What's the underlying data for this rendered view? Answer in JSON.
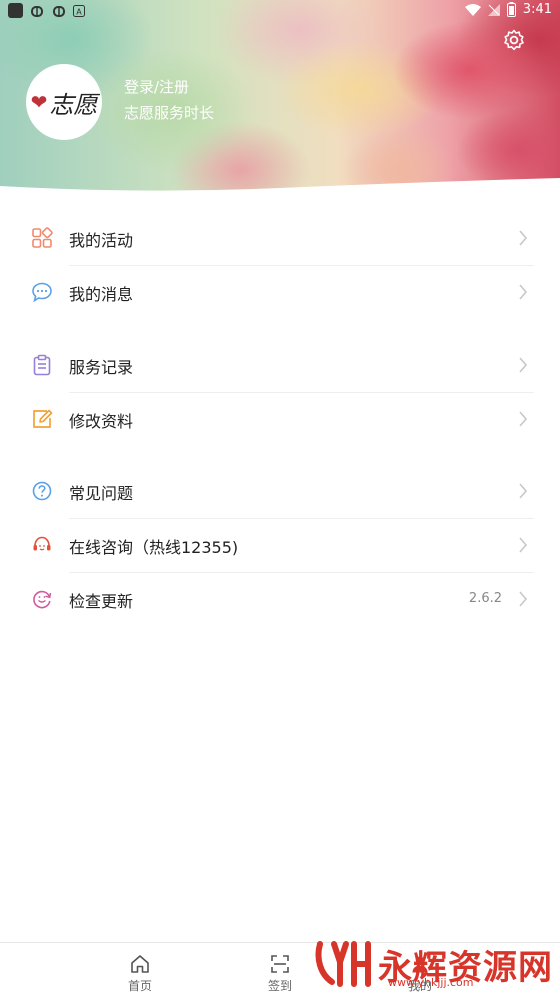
{
  "status_bar": {
    "time": "3:41"
  },
  "profile": {
    "avatar_text": "志愿",
    "login_label": "登录/注册",
    "hours_label": "志愿服务时长"
  },
  "menu": [
    {
      "label": "我的活动",
      "icon": "grid-icon",
      "color": "#f08a6a"
    },
    {
      "label": "我的消息",
      "icon": "chat-bubble-icon",
      "color": "#5aa0e6"
    },
    {
      "label": "服务记录",
      "icon": "clipboard-icon",
      "color": "#9a7fd8"
    },
    {
      "label": "修改资料",
      "icon": "edit-icon",
      "color": "#f2a23a"
    },
    {
      "label": "常见问题",
      "icon": "question-icon",
      "color": "#5aa0e6"
    },
    {
      "label": "在线咨询（热线12355)",
      "icon": "headset-icon",
      "color": "#e0503c"
    },
    {
      "label": "检查更新",
      "icon": "refresh-smile-icon",
      "color": "#d05aa0",
      "value": "2.6.2"
    }
  ],
  "tabbar": [
    {
      "label": "首页",
      "icon": "home-icon"
    },
    {
      "label": "签到",
      "icon": "scan-icon"
    },
    {
      "label": "我的",
      "icon": "user-icon"
    }
  ],
  "watermark": {
    "text": "永辉资源网",
    "url": "www.yhkjjj.com"
  }
}
